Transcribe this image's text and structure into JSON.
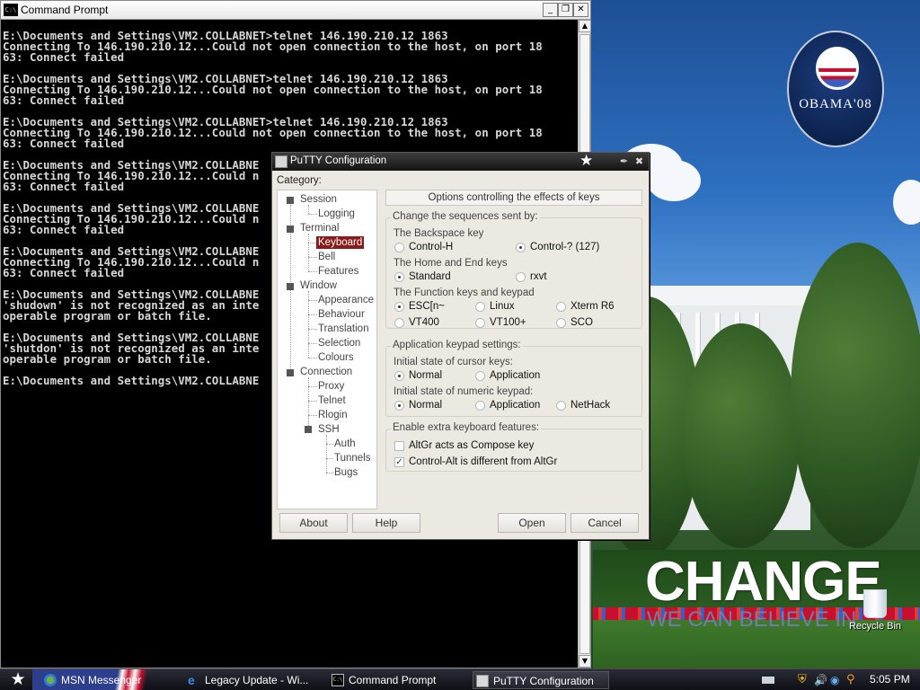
{
  "desktop": {
    "poster_headline": "CHANGE",
    "poster_tagline": "WE CAN BELIEVE IN",
    "logo_text": "OBAMA'08",
    "recycle_bin_label": "Recycle Bin"
  },
  "cmd": {
    "title": "Command Prompt",
    "lines": [
      "E:\\Documents and Settings\\VM2.COLLABNET>telnet 146.190.210.12 1863",
      "Connecting To 146.190.210.12...Could not open connection to the host, on port 18",
      "63: Connect failed",
      "",
      "E:\\Documents and Settings\\VM2.COLLABNET>telnet 146.190.210.12 1863",
      "Connecting To 146.190.210.12...Could not open connection to the host, on port 18",
      "63: Connect failed",
      "",
      "E:\\Documents and Settings\\VM2.COLLABNET>telnet 146.190.210.12 1863",
      "Connecting To 146.190.210.12...Could not open connection to the host, on port 18",
      "63: Connect failed",
      "",
      "E:\\Documents and Settings\\VM2.COLLABNE",
      "Connecting To 146.190.210.12...Could n",
      "63: Connect failed",
      "",
      "E:\\Documents and Settings\\VM2.COLLABNE",
      "Connecting To 146.190.210.12...Could n",
      "63: Connect failed",
      "",
      "E:\\Documents and Settings\\VM2.COLLABNE",
      "Connecting To 146.190.210.12...Could n",
      "63: Connect failed",
      "",
      "E:\\Documents and Settings\\VM2.COLLABNE",
      "'shudown' is not recognized as an inte",
      "operable program or batch file.",
      "",
      "E:\\Documents and Settings\\VM2.COLLABNE",
      "'shutdon' is not recognized as an inte",
      "operable program or batch file.",
      "",
      "E:\\Documents and Settings\\VM2.COLLABNE"
    ]
  },
  "putty": {
    "title": "PuTTY Configuration",
    "category_label": "Category:",
    "tree": {
      "session": "Session",
      "logging": "Logging",
      "terminal": "Terminal",
      "keyboard": "Keyboard",
      "bell": "Bell",
      "features": "Features",
      "window": "Window",
      "appearance": "Appearance",
      "behaviour": "Behaviour",
      "translation": "Translation",
      "selection": "Selection",
      "colours": "Colours",
      "connection": "Connection",
      "proxy": "Proxy",
      "telnet": "Telnet",
      "rlogin": "Rlogin",
      "ssh": "SSH",
      "auth": "Auth",
      "tunnels": "Tunnels",
      "bugs": "Bugs"
    },
    "panel_header": "Options controlling the effects of keys",
    "sequences": {
      "title": "Change the sequences sent by:",
      "backspace_label": "The Backspace key",
      "backspace_ctrl_h": "Control-H",
      "backspace_ctrl_q": "Control-? (127)",
      "home_end_label": "The Home and End keys",
      "home_standard": "Standard",
      "home_rxvt": "rxvt",
      "function_label": "The Function keys and keypad",
      "fn_esc": "ESC[n~",
      "fn_linux": "Linux",
      "fn_xterm": "Xterm R6",
      "fn_vt400": "VT400",
      "fn_vt100": "VT100+",
      "fn_sco": "SCO"
    },
    "keypad": {
      "title": "Application keypad settings:",
      "cursor_label": "Initial state of cursor keys:",
      "cursor_normal": "Normal",
      "cursor_application": "Application",
      "numeric_label": "Initial state of numeric keypad:",
      "numeric_normal": "Normal",
      "numeric_application": "Application",
      "numeric_nethack": "NetHack"
    },
    "extra": {
      "title": "Enable extra keyboard features:",
      "altgr_compose": "AltGr acts as Compose key",
      "ctrl_alt_diff": "Control-Alt is different from AltGr"
    },
    "buttons": {
      "about": "About",
      "help": "Help",
      "open": "Open",
      "cancel": "Cancel"
    }
  },
  "taskbar": {
    "tasks": [
      {
        "label": "MSN Messenger"
      },
      {
        "label": "Legacy Update - Wi..."
      },
      {
        "label": "Command Prompt"
      },
      {
        "label": "PuTTY Configuration"
      }
    ],
    "clock": "5:05 PM"
  },
  "colors": {
    "selected_category": "#8b1a1a",
    "cmd_background": "#000000",
    "cmd_text": "#d8d8d8"
  }
}
